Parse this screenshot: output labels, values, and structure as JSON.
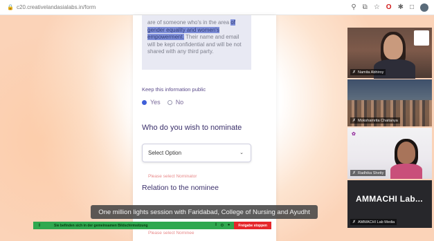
{
  "browser": {
    "url": "c20.creativelandasialabs.in/form",
    "toolbar_icons": [
      "pin-icon",
      "extensions-icon",
      "star-icon",
      "opera-icon",
      "puzzle-icon",
      "sidebar-icon",
      "profile-icon"
    ]
  },
  "form": {
    "consent_text_pre": "",
    "consent_highlight": "of gender equality and women's empowerment.",
    "consent_text_post": "Their name and email will be kept confidential and will be not shared with any third party.",
    "consent_text_top": "are of someone who's in the area",
    "keep_public_label": "Keep this information public",
    "radio_yes": "Yes",
    "radio_no": "No",
    "radio_selected": "Yes",
    "nominate_question": "Who do you wish to nominate",
    "select_placeholder": "Select Option",
    "error_nominator": "Please select Nominator",
    "relation_question": "Relation to the nominee",
    "error_nominee": "Please select Nominee"
  },
  "caption": {
    "text": "One million lights session with Faridabad, College of Nursing and Ayudht"
  },
  "share_bar": {
    "message": "Sie befinden sich in der gemeinsamen Bildschirmsitzung",
    "stop_label": "Freigabe stoppen"
  },
  "video_tiles": [
    {
      "name": "Namita Abhiroy"
    },
    {
      "name": "Mokshamrita Chaitanya"
    },
    {
      "name": "Radhika Shetty"
    },
    {
      "name": "AMMACHI Lab Media",
      "display": "AMMACHI Lab..."
    }
  ],
  "colors": {
    "accent": "#3f5fd8",
    "share_green": "#2fa84f",
    "stop_red": "#e5262a",
    "error": "#e88a8a"
  }
}
